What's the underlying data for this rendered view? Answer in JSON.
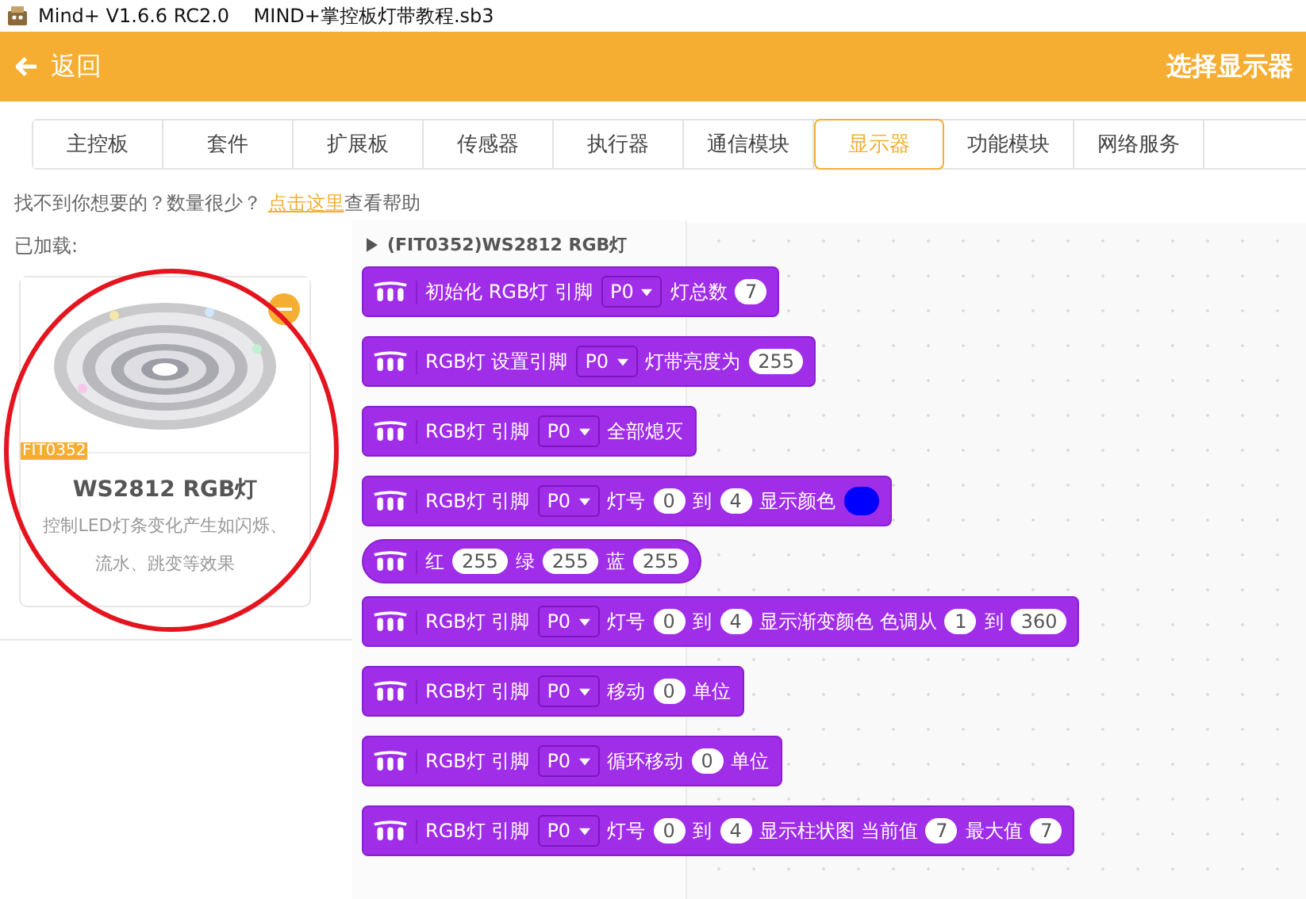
{
  "window": {
    "title": "Mind+ V1.6.6 RC2.0    MIND+掌控板灯带教程.sb3"
  },
  "header": {
    "back": "返回",
    "title": "选择显示器"
  },
  "tabs": [
    {
      "label": "主控板",
      "selected": false
    },
    {
      "label": "套件",
      "selected": false
    },
    {
      "label": "扩展板",
      "selected": false
    },
    {
      "label": "传感器",
      "selected": false
    },
    {
      "label": "执行器",
      "selected": false
    },
    {
      "label": "通信模块",
      "selected": false
    },
    {
      "label": "显示器",
      "selected": true
    },
    {
      "label": "功能模块",
      "selected": false
    },
    {
      "label": "网络服务",
      "selected": false
    }
  ],
  "help": {
    "text": "找不到你想要的？数量很少？ ",
    "link": "点击这里",
    "after": "查看帮助"
  },
  "loaded_label": "已加载:",
  "card": {
    "tag": "FIT0352",
    "name": "WS2812 RGB灯",
    "description": "控制LED灯条变化产生如闪烁、流水、跳变等效果"
  },
  "flyout": {
    "title": "(FIT0352)WS2812 RGB灯",
    "blocks": [
      {
        "kind": "stack",
        "parts": [
          {
            "kind": "text",
            "text": "初始化 RGB灯 引脚"
          },
          {
            "kind": "dropdown",
            "text": "P0"
          },
          {
            "kind": "text",
            "text": "灯总数"
          },
          {
            "kind": "number",
            "text": "7"
          }
        ]
      },
      {
        "kind": "stack",
        "parts": [
          {
            "kind": "text",
            "text": "RGB灯 设置引脚"
          },
          {
            "kind": "dropdown",
            "text": "P0"
          },
          {
            "kind": "text",
            "text": "灯带亮度为"
          },
          {
            "kind": "number",
            "text": "255"
          }
        ]
      },
      {
        "kind": "stack",
        "parts": [
          {
            "kind": "text",
            "text": "RGB灯 引脚"
          },
          {
            "kind": "dropdown",
            "text": "P0"
          },
          {
            "kind": "text",
            "text": "全部熄灭"
          }
        ]
      },
      {
        "kind": "stack",
        "parts": [
          {
            "kind": "text",
            "text": "RGB灯 引脚"
          },
          {
            "kind": "dropdown",
            "text": "P0"
          },
          {
            "kind": "text",
            "text": "灯号"
          },
          {
            "kind": "number",
            "text": "0"
          },
          {
            "kind": "text",
            "text": "到"
          },
          {
            "kind": "number",
            "text": "4"
          },
          {
            "kind": "text",
            "text": "显示颜色"
          },
          {
            "kind": "color",
            "color": "#0000ff"
          }
        ]
      },
      {
        "kind": "reporter",
        "parts": [
          {
            "kind": "text",
            "text": "红"
          },
          {
            "kind": "number",
            "text": "255"
          },
          {
            "kind": "text",
            "text": "绿"
          },
          {
            "kind": "number",
            "text": "255"
          },
          {
            "kind": "text",
            "text": "蓝"
          },
          {
            "kind": "number",
            "text": "255"
          }
        ]
      },
      {
        "kind": "stack",
        "parts": [
          {
            "kind": "text",
            "text": "RGB灯 引脚"
          },
          {
            "kind": "dropdown",
            "text": "P0"
          },
          {
            "kind": "text",
            "text": "灯号"
          },
          {
            "kind": "number",
            "text": "0"
          },
          {
            "kind": "text",
            "text": "到"
          },
          {
            "kind": "number",
            "text": "4"
          },
          {
            "kind": "text",
            "text": "显示渐变颜色 色调从"
          },
          {
            "kind": "number",
            "text": "1"
          },
          {
            "kind": "text",
            "text": "到"
          },
          {
            "kind": "number",
            "text": "360"
          }
        ]
      },
      {
        "kind": "stack",
        "parts": [
          {
            "kind": "text",
            "text": "RGB灯 引脚"
          },
          {
            "kind": "dropdown",
            "text": "P0"
          },
          {
            "kind": "text",
            "text": "移动"
          },
          {
            "kind": "number",
            "text": "0"
          },
          {
            "kind": "text",
            "text": "单位"
          }
        ]
      },
      {
        "kind": "stack",
        "parts": [
          {
            "kind": "text",
            "text": "RGB灯 引脚"
          },
          {
            "kind": "dropdown",
            "text": "P0"
          },
          {
            "kind": "text",
            "text": "循环移动"
          },
          {
            "kind": "number",
            "text": "0"
          },
          {
            "kind": "text",
            "text": "单位"
          }
        ]
      },
      {
        "kind": "stack",
        "parts": [
          {
            "kind": "text",
            "text": "RGB灯 引脚"
          },
          {
            "kind": "dropdown",
            "text": "P0"
          },
          {
            "kind": "text",
            "text": "灯号"
          },
          {
            "kind": "number",
            "text": "0"
          },
          {
            "kind": "text",
            "text": "到"
          },
          {
            "kind": "number",
            "text": "4"
          },
          {
            "kind": "text",
            "text": "显示柱状图 当前值"
          },
          {
            "kind": "number",
            "text": "7"
          },
          {
            "kind": "text",
            "text": "最大值"
          },
          {
            "kind": "number",
            "text": "7"
          }
        ]
      }
    ]
  }
}
